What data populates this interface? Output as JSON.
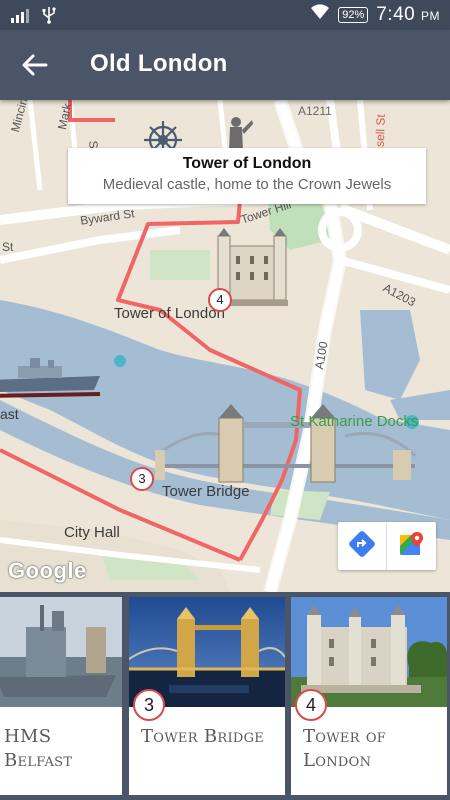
{
  "status": {
    "battery": "92%",
    "time": "7:40",
    "ampm": "PM"
  },
  "appbar": {
    "title": "Old London"
  },
  "map": {
    "callout": {
      "title": "Tower of London",
      "subtitle": "Medieval castle, home to the Crown Jewels"
    },
    "streets": {
      "mincing": "Mincing L",
      "seething": "Seeth",
      "mark": "Mark Ln",
      "byward": "Byward St",
      "tower_hill": "Tower Hill",
      "a1211": "A1211",
      "a1203": "A1203",
      "a100": "A100",
      "mansell": "Mansell St",
      "st": "St"
    },
    "places": {
      "tower_of_london": "Tower of London",
      "tower_bridge": "Tower Bridge",
      "city_hall": "City Hall",
      "st_katharine": "St Katharine Docks",
      "ast": "ast"
    },
    "pins": {
      "tower": "4",
      "bridge": "3"
    },
    "google": "Google"
  },
  "cards": [
    {
      "label": "HMS Belfast",
      "number": ""
    },
    {
      "label": "Tower Bridge",
      "number": "3"
    },
    {
      "label": "Tower of London",
      "number": "4"
    }
  ],
  "colors": {
    "route": "#f06565",
    "water": "#a5bdd3",
    "appbar": "#4a5668"
  }
}
